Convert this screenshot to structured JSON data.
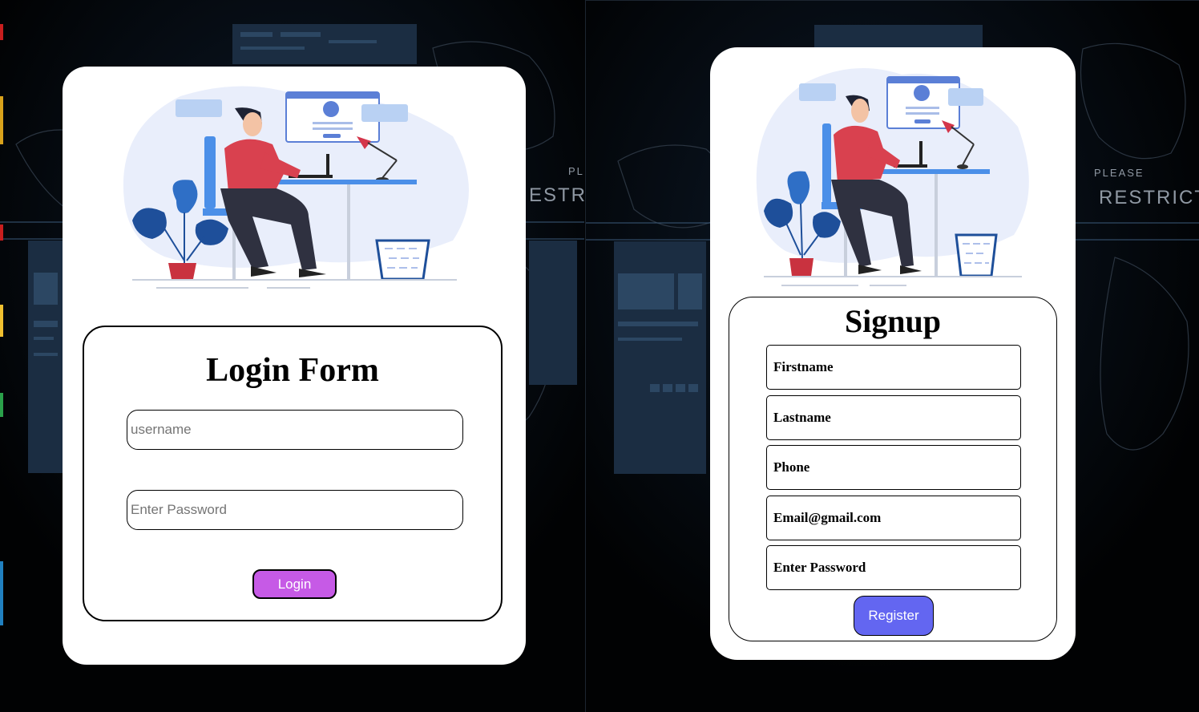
{
  "login": {
    "title": "Login Form",
    "username_placeholder": "username",
    "password_placeholder": "Enter Password",
    "button_label": "Login",
    "button_color": "#c65ae6"
  },
  "signup": {
    "title": "Signup",
    "fields": [
      {
        "placeholder": "Firstname"
      },
      {
        "placeholder": "Lastname"
      },
      {
        "placeholder": "Phone"
      },
      {
        "placeholder": "Email@gmail.com"
      },
      {
        "placeholder": "Enter Password"
      }
    ],
    "button_label": "Register",
    "button_color": "#6366f1"
  },
  "background": {
    "left_caption_small": "PL",
    "left_caption_large": "ESTRIC",
    "right_caption_small": "PLEASE",
    "right_caption_large": "RESTRICTE"
  },
  "icons": [
    "person-at-desk-illustration",
    "monstera-plant-icon",
    "waste-basket-icon",
    "desk-lamp-icon",
    "login-window-icon"
  ]
}
